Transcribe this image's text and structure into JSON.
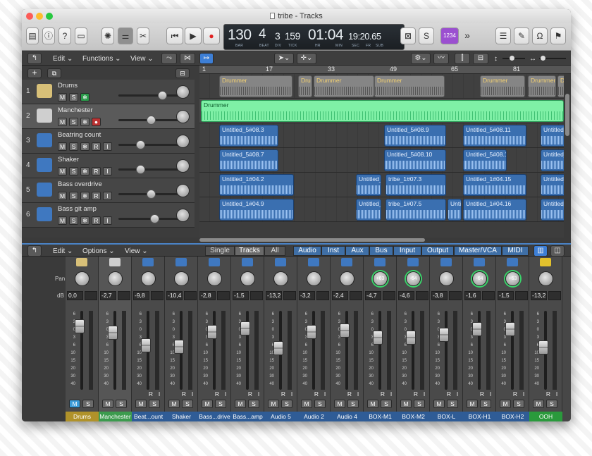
{
  "window": {
    "title": "tribe - Tracks"
  },
  "lcd": {
    "bar": "130",
    "beat": "4",
    "div": "3",
    "tick": "159",
    "time": "01:04",
    "sub": "19:20.65",
    "labels": [
      "BAR",
      "BEAT",
      "DIV",
      "TICK",
      "HR",
      "MIN",
      "SEC",
      "FR",
      "SUB"
    ]
  },
  "toolbar": {
    "midi_tag": "1234",
    "more": "»"
  },
  "control_bar": {
    "edit": "Edit",
    "functions": "Functions",
    "view": "View"
  },
  "ruler": [
    "1",
    "17",
    "33",
    "49",
    "65",
    "81"
  ],
  "tracks": [
    {
      "num": "1",
      "name": "Drums",
      "buttons": [
        "M",
        "S",
        "❄"
      ],
      "vol": 0.78,
      "icon_color": "#d8c078"
    },
    {
      "num": "2",
      "name": "Manchester",
      "buttons": [
        "M",
        "S",
        "❄",
        "●"
      ],
      "vol": 0.55,
      "icon_color": "#cfcfcf"
    },
    {
      "num": "3",
      "name": "Beatring count",
      "buttons": [
        "M",
        "S",
        "❄",
        "R",
        "I"
      ],
      "vol": 0.35,
      "icon_color": "#3f78c0"
    },
    {
      "num": "4",
      "name": "Shaker",
      "buttons": [
        "M",
        "S",
        "❄",
        "R",
        "I"
      ],
      "vol": 0.35,
      "icon_color": "#3f78c0"
    },
    {
      "num": "5",
      "name": "Bass overdrive",
      "buttons": [
        "M",
        "S",
        "❄",
        "R",
        "I"
      ],
      "vol": 0.55,
      "icon_color": "#3f78c0"
    },
    {
      "num": "6",
      "name": "Bass git amp",
      "buttons": [
        "M",
        "S",
        "❄",
        "R",
        "I"
      ],
      "vol": 0.62,
      "icon_color": "#3f78c0"
    }
  ],
  "regions": [
    [
      {
        "label": "Drummer",
        "kind": "drum",
        "start": 28,
        "len": 104
      },
      {
        "label": "Dru",
        "kind": "drum",
        "start": 140,
        "len": 20
      },
      {
        "label": "Drummer",
        "kind": "drum",
        "start": 162,
        "len": 86
      },
      {
        "label": "Drummer",
        "kind": "drum",
        "start": 248,
        "len": 100
      },
      {
        "label": "Drummer",
        "kind": "drum",
        "start": 398,
        "len": 64
      },
      {
        "label": "Drummer",
        "kind": "drum",
        "start": 466,
        "len": 40
      },
      {
        "label": "Drummer",
        "kind": "drum",
        "start": 508,
        "len": 40
      }
    ],
    [
      {
        "label": "Drummer",
        "kind": "green",
        "start": 2,
        "len": 515
      }
    ],
    [
      {
        "label": "Untitled_5#08.3",
        "kind": "blue",
        "start": 28,
        "len": 84
      },
      {
        "label": "Untitled_5#08.9",
        "kind": "blue",
        "start": 262,
        "len": 88
      },
      {
        "label": "Untitled_5#08.11",
        "kind": "blue",
        "start": 374,
        "len": 90
      },
      {
        "label": "Untitled_5",
        "kind": "blue",
        "start": 484,
        "len": 40
      }
    ],
    [
      {
        "label": "Untitled_5#08.7",
        "kind": "blue",
        "start": 28,
        "len": 84
      },
      {
        "label": "Untitled_5#08.10",
        "kind": "blue",
        "start": 262,
        "len": 88
      },
      {
        "label": "Untitled_5#08.1",
        "kind": "blue",
        "start": 374,
        "len": 62
      },
      {
        "label": "Untitled_5",
        "kind": "blue",
        "start": 484,
        "len": 40
      }
    ],
    [
      {
        "label": "Untitled_1#04.2",
        "kind": "blue",
        "start": 28,
        "len": 106
      },
      {
        "label": "Untitled_",
        "kind": "blue",
        "start": 222,
        "len": 36
      },
      {
        "label": "tribe_1#07.3",
        "kind": "blue",
        "start": 264,
        "len": 86
      },
      {
        "label": "Untitled_1#04.15",
        "kind": "blue",
        "start": 374,
        "len": 90
      },
      {
        "label": "Untitled_",
        "kind": "blue",
        "start": 484,
        "len": 40
      }
    ],
    [
      {
        "label": "Untitled_1#04.9",
        "kind": "blue",
        "start": 28,
        "len": 106
      },
      {
        "label": "Untitled_",
        "kind": "blue",
        "start": 222,
        "len": 36
      },
      {
        "label": "tribe_1#07.5",
        "kind": "blue",
        "start": 264,
        "len": 86
      },
      {
        "label": "Unti",
        "kind": "blue",
        "start": 352,
        "len": 20
      },
      {
        "label": "Untitled_1#04.16",
        "kind": "blue",
        "start": 374,
        "len": 90
      },
      {
        "label": "Untitled_",
        "kind": "blue",
        "start": 484,
        "len": 40
      }
    ]
  ],
  "mixer_bar": {
    "edit": "Edit",
    "options": "Options",
    "view": "View",
    "filters": [
      "Single",
      "Tracks",
      "All"
    ],
    "types": [
      "Audio",
      "Inst",
      "Aux",
      "Bus",
      "Input",
      "Output",
      "Master/VCA",
      "MIDI"
    ]
  },
  "mixer_labels": {
    "pan": "Pan",
    "db": "dB"
  },
  "meter_scale": [
    "6",
    "3",
    "0",
    "3",
    "6",
    "10",
    "15",
    "20",
    "30",
    "40",
    "50",
    "60"
  ],
  "strips": [
    {
      "name": "Drums",
      "db": "0,0",
      "fader": 0.13,
      "pan": "",
      "ring": false,
      "ri": false,
      "name_color": "#b0922a",
      "icon_color": "#d8c078",
      "m_on": true
    },
    {
      "name": "Manchester",
      "db": "-2,7",
      "fader": 0.23,
      "pan": "",
      "ring": false,
      "ri": false,
      "name_color": "#3c9b4e",
      "icon_color": "#cfcfcf",
      "m_on": false,
      "selected": true
    },
    {
      "name": "Beat...ount",
      "db": "-9,8",
      "fader": 0.42,
      "pan": "",
      "ring": false,
      "ri": true,
      "name_color": "#2f5c96",
      "icon_color": "#3f78c0"
    },
    {
      "name": "Shaker",
      "db": "-10,4",
      "fader": 0.45,
      "pan": "",
      "ring": false,
      "ri": true,
      "name_color": "#2f5c96",
      "icon_color": "#3f78c0"
    },
    {
      "name": "Bass...drive",
      "db": "-2,8",
      "fader": 0.22,
      "pan": "",
      "ring": false,
      "ri": true,
      "name_color": "#2f5c96",
      "icon_color": "#3f78c0"
    },
    {
      "name": "Bass...amp",
      "db": "-1,5",
      "fader": 0.16,
      "pan": "",
      "ring": false,
      "ri": true,
      "name_color": "#2f5c96",
      "icon_color": "#3f78c0"
    },
    {
      "name": "Audio 5",
      "db": "-13,2",
      "fader": 0.47,
      "pan": "",
      "ring": false,
      "ri": true,
      "name_color": "#2f5c96",
      "icon_color": "#3f78c0"
    },
    {
      "name": "Audio 2",
      "db": "-3,2",
      "fader": 0.22,
      "pan": "",
      "ring": false,
      "ri": true,
      "name_color": "#2f5c96",
      "icon_color": "#3f78c0"
    },
    {
      "name": "Audio 4",
      "db": "-2,4",
      "fader": 0.2,
      "pan": "",
      "ring": false,
      "ri": true,
      "name_color": "#2f5c96",
      "icon_color": "#3f78c0"
    },
    {
      "name": "BOX-M1",
      "db": "-4,7",
      "fader": 0.3,
      "pan": "+63",
      "ring": true,
      "ri": true,
      "name_color": "#2f5c96",
      "icon_color": "#3f78c0"
    },
    {
      "name": "BOX-M2",
      "db": "-4,6",
      "fader": 0.3,
      "pan": "-64",
      "ring": true,
      "ri": true,
      "name_color": "#2f5c96",
      "icon_color": "#3f78c0"
    },
    {
      "name": "BOX-L",
      "db": "-3,8",
      "fader": 0.26,
      "pan": "",
      "ring": false,
      "ri": true,
      "name_color": "#2f5c96",
      "icon_color": "#3f78c0"
    },
    {
      "name": "BOX-H1",
      "db": "-1,6",
      "fader": 0.17,
      "pan": "-64",
      "ring": true,
      "ri": true,
      "name_color": "#2f5c96",
      "icon_color": "#3f78c0"
    },
    {
      "name": "BOX-H2",
      "db": "-1,5",
      "fader": 0.17,
      "pan": "+63",
      "ring": true,
      "ri": true,
      "name_color": "#2f5c96",
      "icon_color": "#3f78c0"
    },
    {
      "name": "OOH",
      "db": "-13,2",
      "fader": 0.46,
      "pan": "",
      "ring": false,
      "ri": true,
      "name_color": "#2a9a3c",
      "icon_color": "#e2c12d"
    }
  ]
}
